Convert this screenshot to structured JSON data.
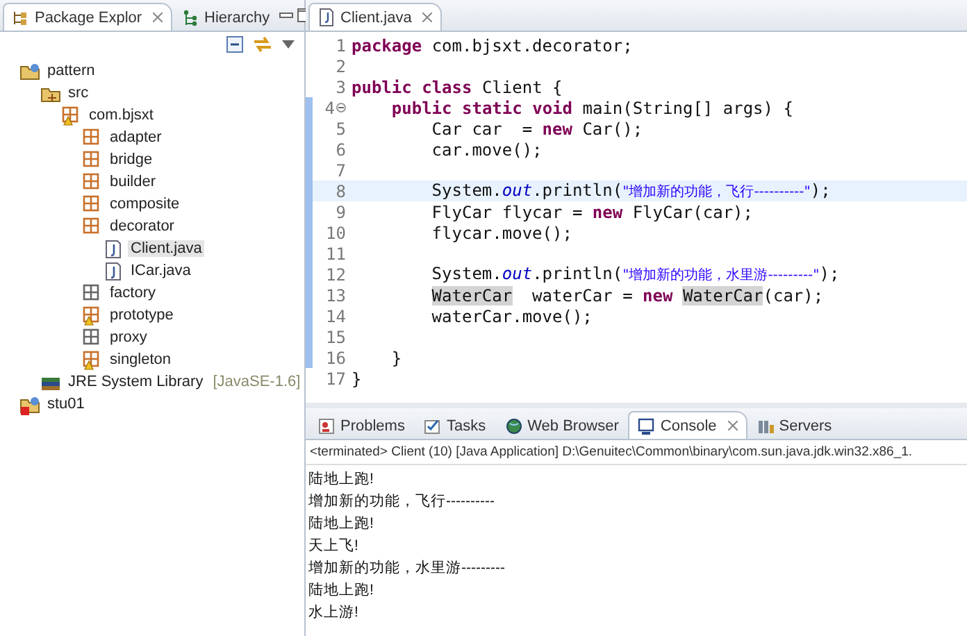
{
  "explorer": {
    "tabs": [
      {
        "label": "Package Explor",
        "selected": true
      },
      {
        "label": "Hierarchy",
        "selected": false
      }
    ],
    "tree": [
      {
        "kind": "project",
        "label": "pattern",
        "selected": false,
        "children": [
          {
            "kind": "source-folder",
            "label": "src",
            "selected": false,
            "children": [
              {
                "kind": "package-warning",
                "label": "com.bjsxt",
                "selected": false,
                "children": [
                  {
                    "kind": "package",
                    "label": "adapter",
                    "selected": false
                  },
                  {
                    "kind": "package",
                    "label": "bridge",
                    "selected": false
                  },
                  {
                    "kind": "package",
                    "label": "builder",
                    "selected": false
                  },
                  {
                    "kind": "package",
                    "label": "composite",
                    "selected": false
                  },
                  {
                    "kind": "package",
                    "label": "decorator",
                    "selected": false,
                    "children": [
                      {
                        "kind": "java-file",
                        "label": "Client.java",
                        "selected": true
                      },
                      {
                        "kind": "java-file",
                        "label": "ICar.java",
                        "selected": false
                      }
                    ]
                  },
                  {
                    "kind": "package-empty",
                    "label": "factory",
                    "selected": false
                  },
                  {
                    "kind": "package-warning",
                    "label": "prototype",
                    "selected": false
                  },
                  {
                    "kind": "package-empty",
                    "label": "proxy",
                    "selected": false
                  },
                  {
                    "kind": "package-warning",
                    "label": "singleton",
                    "selected": false
                  }
                ]
              }
            ]
          },
          {
            "kind": "library",
            "label": "JRE System Library",
            "decoration": "[JavaSE-1.6]",
            "selected": false
          }
        ]
      },
      {
        "kind": "project-error",
        "label": "stu01",
        "selected": false
      }
    ]
  },
  "editor": {
    "tab": "Client.java",
    "lines": [
      {
        "number": "1",
        "changed": false,
        "current": false,
        "tokens": [
          {
            "kind": "keyword",
            "text": "package"
          },
          {
            "kind": "plain",
            "text": " com.bjsxt.decorator;"
          }
        ]
      },
      {
        "number": "2",
        "changed": false,
        "current": false
      },
      {
        "number": "3",
        "changed": false,
        "current": false,
        "tokens": [
          {
            "kind": "keyword",
            "text": "public"
          },
          {
            "kind": "keyword",
            "text": " class"
          },
          {
            "kind": "plain",
            "text": " Client {"
          }
        ]
      },
      {
        "number": "4",
        "changed": true,
        "current": false,
        "fold": true,
        "tokens": [
          {
            "kind": "keyword",
            "text": "    public"
          },
          {
            "kind": "keyword",
            "text": " static"
          },
          {
            "kind": "keyword",
            "text": " void"
          },
          {
            "kind": "plain",
            "text": " main(String[] args) {"
          }
        ]
      },
      {
        "number": "5",
        "changed": true,
        "current": false,
        "tokens": [
          {
            "kind": "plain",
            "text": "        Car car  = "
          },
          {
            "kind": "keyword",
            "text": "new"
          },
          {
            "kind": "plain",
            "text": " Car();"
          }
        ]
      },
      {
        "number": "6",
        "changed": true,
        "current": false,
        "tokens": [
          {
            "kind": "plain",
            "text": "        car.move();"
          }
        ]
      },
      {
        "number": "7",
        "changed": true,
        "current": false
      },
      {
        "number": "8",
        "changed": true,
        "current": true,
        "tokens": [
          {
            "kind": "plain",
            "text": "        System."
          },
          {
            "kind": "field",
            "text": "out"
          },
          {
            "kind": "plain",
            "text": ".println("
          },
          {
            "kind": "string",
            "text": "\"增加新的功能，飞行----------\""
          },
          {
            "kind": "plain",
            "text": ");"
          }
        ]
      },
      {
        "number": "9",
        "changed": true,
        "current": false,
        "tokens": [
          {
            "kind": "plain",
            "text": "        FlyCar flycar = "
          },
          {
            "kind": "keyword",
            "text": "new"
          },
          {
            "kind": "plain",
            "text": " FlyCar(car);"
          }
        ]
      },
      {
        "number": "10",
        "changed": true,
        "current": false,
        "tokens": [
          {
            "kind": "plain",
            "text": "        flycar.move();"
          }
        ]
      },
      {
        "number": "11",
        "changed": true,
        "current": false
      },
      {
        "number": "12",
        "changed": true,
        "current": false,
        "tokens": [
          {
            "kind": "plain",
            "text": "        System."
          },
          {
            "kind": "field",
            "text": "out"
          },
          {
            "kind": "plain",
            "text": ".println("
          },
          {
            "kind": "string",
            "text": "\"增加新的功能，水里游---------\""
          },
          {
            "kind": "plain",
            "text": ");"
          }
        ]
      },
      {
        "number": "13",
        "changed": true,
        "current": false,
        "tokens": [
          {
            "kind": "occurrence",
            "text": "        WaterCar"
          },
          {
            "kind": "plain",
            "text": "  waterCar = "
          },
          {
            "kind": "keyword",
            "text": "new"
          },
          {
            "kind": "occurrence",
            "text": " WaterCar"
          },
          {
            "kind": "plain",
            "text": "(car);"
          }
        ]
      },
      {
        "number": "14",
        "changed": true,
        "current": false,
        "tokens": [
          {
            "kind": "plain",
            "text": "        waterCar.move();"
          }
        ]
      },
      {
        "number": "15",
        "changed": true,
        "current": false
      },
      {
        "number": "16",
        "changed": true,
        "current": false,
        "tokens": [
          {
            "kind": "plain",
            "text": "    }"
          }
        ]
      },
      {
        "number": "17",
        "changed": false,
        "current": false,
        "tokens": [
          {
            "kind": "plain",
            "text": "}"
          }
        ]
      }
    ]
  },
  "console": {
    "tabs": [
      {
        "kind": "problems",
        "label": "Problems",
        "selected": false
      },
      {
        "kind": "tasks",
        "label": "Tasks",
        "selected": false
      },
      {
        "kind": "browser",
        "label": "Web Browser",
        "selected": false
      },
      {
        "kind": "console",
        "label": "Console",
        "selected": true
      },
      {
        "kind": "servers",
        "label": "Servers",
        "selected": false
      }
    ],
    "header": "<terminated> Client (10) [Java Application] D:\\Genuitec\\Common\\binary\\com.sun.java.jdk.win32.x86_1.",
    "output": [
      "陆地上跑!",
      "增加新的功能，飞行----------",
      "陆地上跑!",
      "天上飞!",
      "增加新的功能，水里游---------",
      "陆地上跑!",
      "水上游!"
    ]
  }
}
